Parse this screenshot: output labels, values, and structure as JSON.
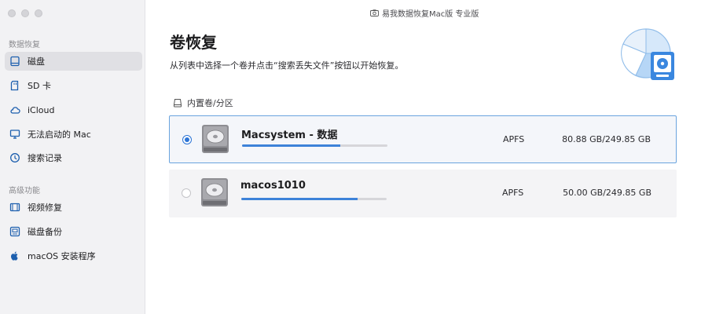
{
  "window": {
    "title": "易我数据恢复Mac版  专业版"
  },
  "sidebar": {
    "section1": "数据恢复",
    "items": [
      {
        "label": "磁盘",
        "icon": "disk-icon",
        "active": true
      },
      {
        "label": "SD 卡",
        "icon": "sd-card-icon",
        "active": false
      },
      {
        "label": "iCloud",
        "icon": "cloud-icon",
        "active": false
      },
      {
        "label": "无法启动的 Mac",
        "icon": "monitor-icon",
        "active": false
      },
      {
        "label": "搜索记录",
        "icon": "history-icon",
        "active": false
      }
    ],
    "section2": "高级功能",
    "advanced": [
      {
        "label": "视频修复",
        "icon": "film-icon"
      },
      {
        "label": "磁盘备份",
        "icon": "backup-icon"
      },
      {
        "label": "macOS 安装程序",
        "icon": "apple-icon"
      }
    ]
  },
  "main": {
    "title": "卷恢复",
    "subtitle": "从列表中选择一个卷并点击“搜索丢失文件”按钮以开始恢复。",
    "group_label": "内置卷/分区",
    "volumes": [
      {
        "name": "Macsystem - 数据",
        "fs": "APFS",
        "size": "80.88 GB/249.85 GB",
        "used_fraction": 0.676,
        "selected": true
      },
      {
        "name": "macos1010",
        "fs": "APFS",
        "size": "50.00 GB/249.85 GB",
        "used_fraction": 0.8,
        "selected": false
      }
    ]
  },
  "colors": {
    "accent": "#2b74d6",
    "bar": "#3d82d9",
    "selected_border": "#6aa4de"
  }
}
